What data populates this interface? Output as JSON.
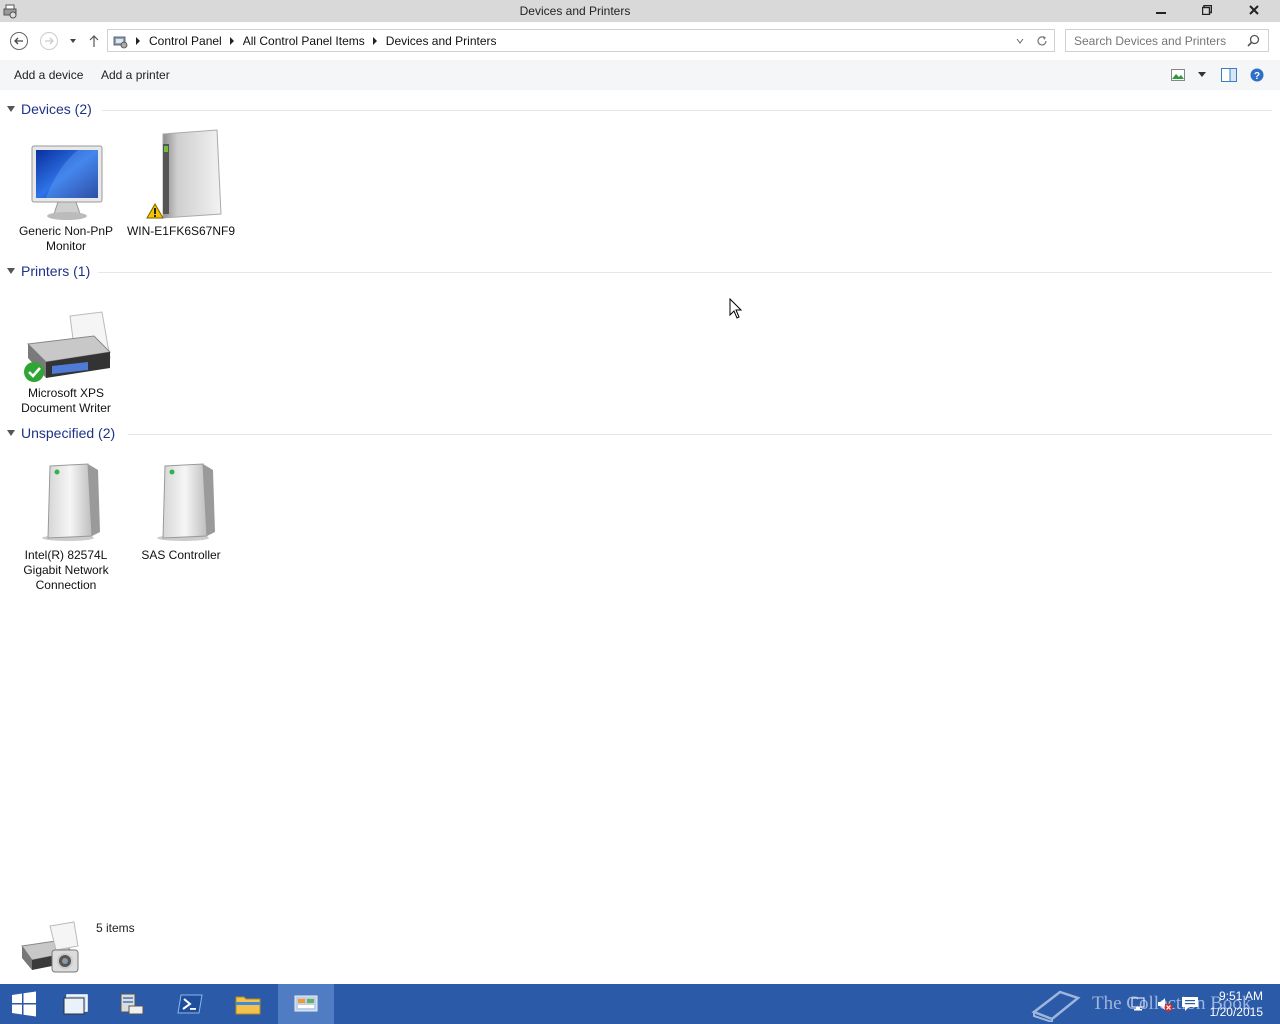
{
  "window": {
    "title": "Devices and Printers",
    "controls": {
      "minimize": "minimize",
      "maximize": "restore",
      "close": "close"
    }
  },
  "nav": {
    "back_icon": "back-arrow-icon",
    "forward_icon": "forward-arrow-icon",
    "recent_icon": "chevron-down-icon",
    "up_icon": "up-arrow-icon"
  },
  "address": {
    "breadcrumbs": [
      "Control Panel",
      "All Control Panel Items",
      "Devices and Printers"
    ]
  },
  "search": {
    "placeholder": "Search Devices and Printers"
  },
  "commands": {
    "add_device": "Add a device",
    "add_printer": "Add a printer"
  },
  "groups": [
    {
      "title": "Devices (2)",
      "items": [
        {
          "label": "Generic Non-PnP Monitor",
          "icon": "monitor-icon"
        },
        {
          "label": "WIN-E1FK6S67NF9",
          "icon": "computer-tower-warning-icon"
        }
      ]
    },
    {
      "title": "Printers (1)",
      "items": [
        {
          "label": "Microsoft XPS Document Writer",
          "icon": "printer-default-icon"
        }
      ]
    },
    {
      "title": "Unspecified (2)",
      "items": [
        {
          "label": "Intel(R) 82574L Gigabit Network Connection",
          "icon": "device-box-icon"
        },
        {
          "label": "SAS Controller",
          "icon": "device-box-icon"
        }
      ]
    }
  ],
  "details": {
    "count": "5 items"
  },
  "taskbar": {
    "time": "9:51 AM",
    "date": "1/20/2015",
    "watermark": "The Collection Book"
  },
  "colors": {
    "group_title": "#1e3287",
    "taskbar": "#2a5aa8",
    "titlebar": "#d9d9d9"
  }
}
